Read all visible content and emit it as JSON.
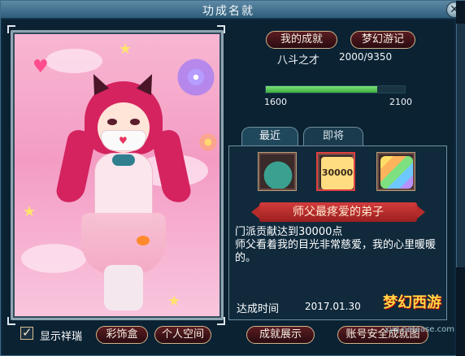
{
  "window": {
    "title": "功成名就"
  },
  "header_buttons": {
    "my_achievements": "我的成就",
    "dream_journey": "梦幻游记"
  },
  "achievement": {
    "name": "八斗之才",
    "progress_text": "2000/9350",
    "bar": {
      "min_label": "1600",
      "max_label": "2100",
      "fill_fraction": 0.8
    }
  },
  "tabs": {
    "recent": "最近",
    "upcoming": "即将"
  },
  "detail": {
    "icons": [
      {
        "name": "vase-icon"
      },
      {
        "name": "coin-30000-icon",
        "text": "30000"
      },
      {
        "name": "rainbow-icon"
      }
    ],
    "title": "师父最疼爱的弟子",
    "desc_line1": "门派贡献达到30000点",
    "desc_line2": "师父看着我的目光非常慈爱，我的心里暖暖的。",
    "date_label": "达成时间",
    "date_value": "2017.01.30"
  },
  "bottom": {
    "show_detail_label": "显示祥瑞",
    "decoration_box": "彩饰盒",
    "personal_space": "个人空间",
    "achievement_display": "成就展示",
    "account_security": "账号安全成就图"
  },
  "logo": {
    "main_text": "梦幻西游",
    "sub_text": "xyq.netease.com"
  },
  "colors": {
    "accent_red": "#9b1f1f",
    "progress_green": "#3fae3e",
    "panel_blue": "#102a3c"
  }
}
